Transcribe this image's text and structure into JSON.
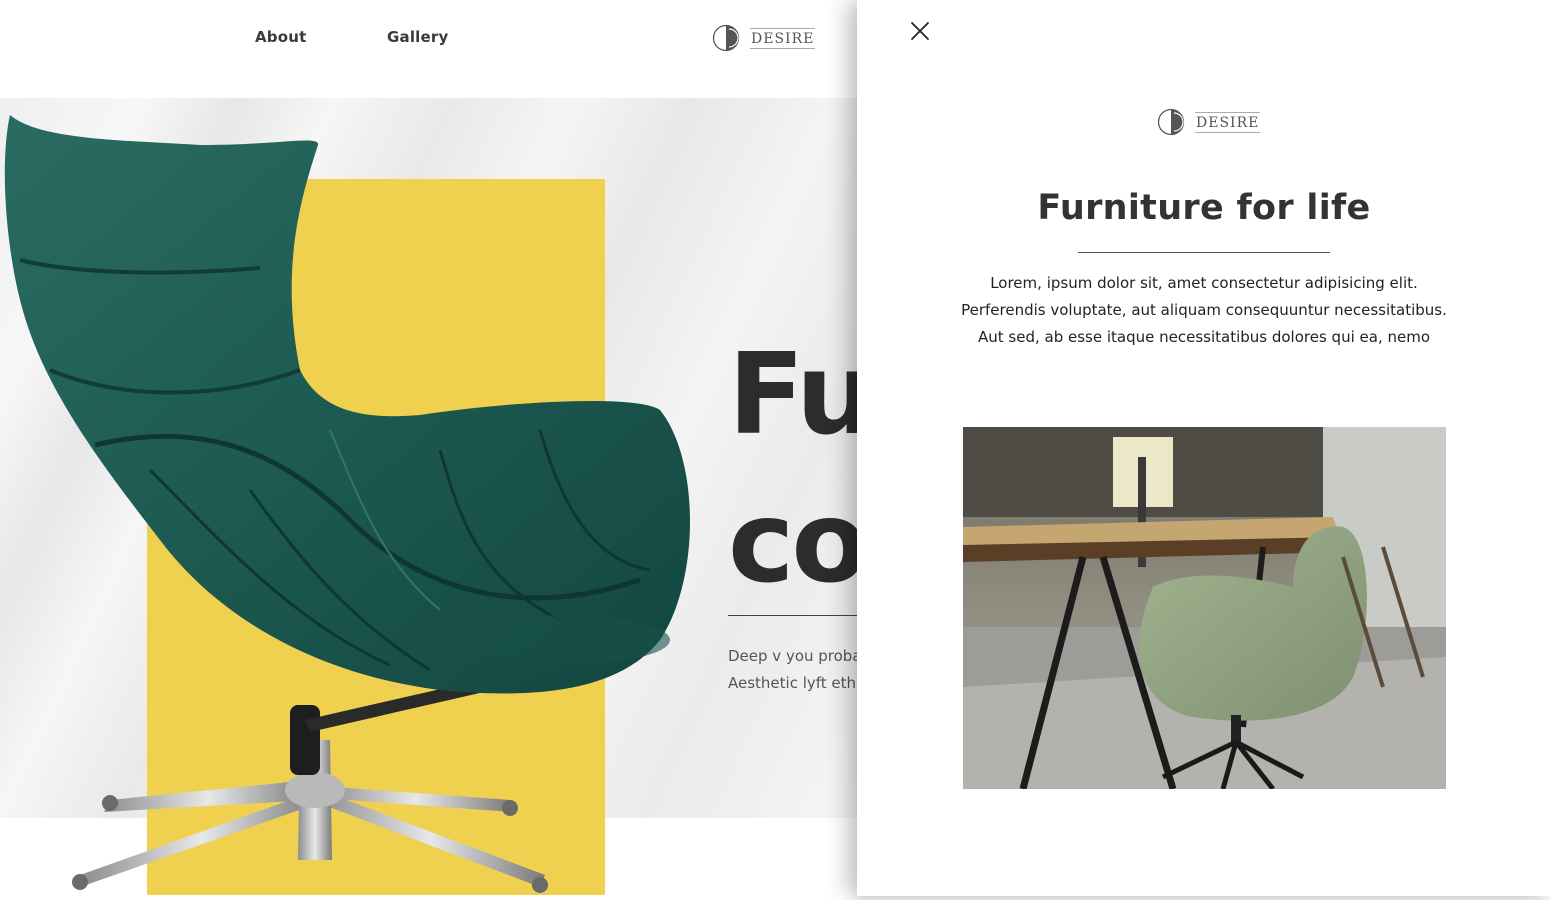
{
  "nav": {
    "about_label": "About",
    "gallery_label": "Gallery"
  },
  "brand": {
    "name": "DESIRE"
  },
  "hero": {
    "title_line1": "Fu",
    "title_line2": "co",
    "copy_line1": "Deep v you proba",
    "copy_line2": "Aesthetic lyft ethi"
  },
  "drawer": {
    "title": "Furniture for life",
    "paragraph_lines": [
      "Lorem, ipsum dolor sit, amet consectetur adipisicing elit.",
      "Perferendis voluptate, aut aliquam consequuntur necessitatibus.",
      "Aut sed, ab esse itaque necessitatibus dolores qui ea, nemo"
    ]
  },
  "icons": {
    "close": "close-icon",
    "logo": "logo-mark-icon"
  },
  "colors": {
    "accent_yellow": "#efd14f",
    "chair_green": "#1f5a52",
    "text_dark": "#2c2c2c"
  }
}
